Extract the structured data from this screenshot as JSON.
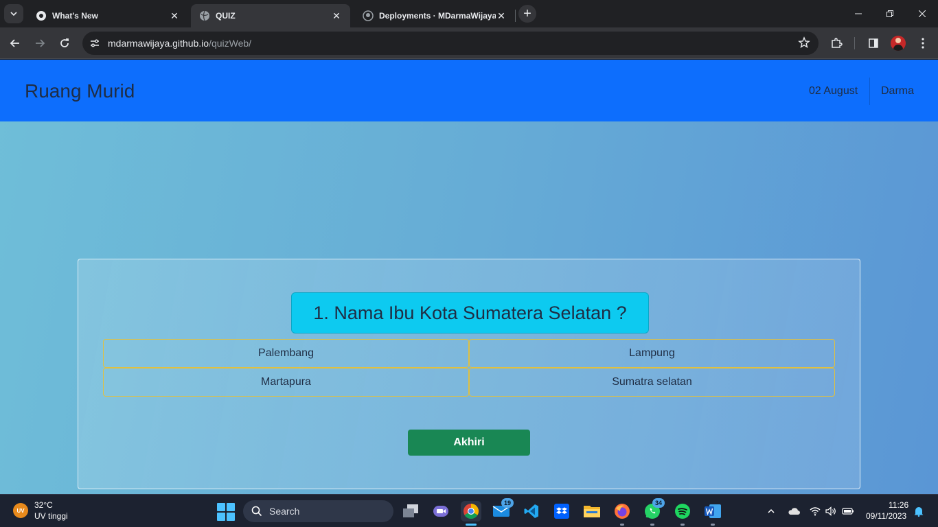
{
  "browser": {
    "tabs": [
      {
        "title": "What's New",
        "active": false
      },
      {
        "title": "QUIZ",
        "active": true
      },
      {
        "title": "Deployments · MDarmaWijaya",
        "active": false
      }
    ],
    "url": {
      "host": "mdarmawijaya.github.io",
      "path": "/quizWeb/"
    }
  },
  "page": {
    "brand": "Ruang Murid",
    "date": "02 August",
    "user": "Darma",
    "question": "1. Nama Ibu Kota Sumatera Selatan ?",
    "options": [
      "Palembang",
      "Lampung",
      "Martapura",
      "Sumatra selatan"
    ],
    "finish_label": "Akhiri",
    "colors": {
      "navbar": "#0d6efd",
      "question_bg": "#0dcaf0",
      "option_border": "#e0c040",
      "finish_bg": "#198754"
    }
  },
  "taskbar": {
    "weather": {
      "icon_label": "UV",
      "temp": "32°C",
      "desc": "UV tinggi"
    },
    "search_label": "Search",
    "mail_badge": "19",
    "whatsapp_badge": "34",
    "time": "11:26",
    "date": "09/11/2023"
  }
}
